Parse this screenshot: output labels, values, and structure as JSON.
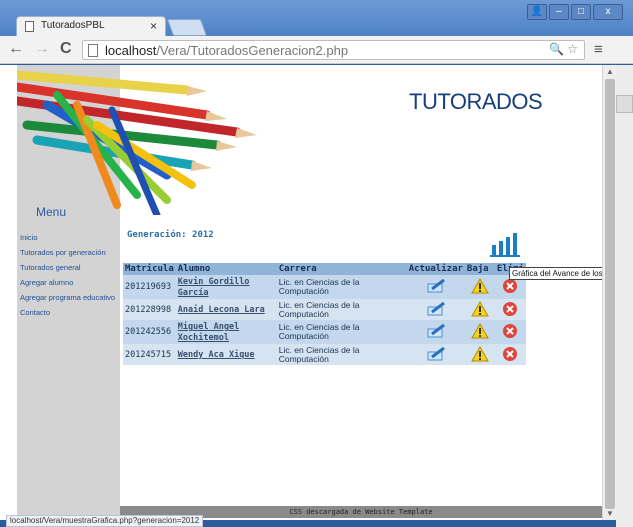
{
  "browser": {
    "tab_title": "TutoradosPBL",
    "tab_close": "×",
    "url_host": "localhost",
    "url_path": "/Vera/TutoradosGeneracion2.php",
    "back": "←",
    "forward": "→",
    "reload": "C",
    "menu": "≡",
    "omni_icons": "🔍 ☆",
    "win_minimize": "–",
    "win_maximize": "□",
    "win_close": "x",
    "win_user": "👤"
  },
  "page": {
    "title": "TUTORADOS",
    "menu_title": "Menu",
    "nav": [
      {
        "label": "Inicio"
      },
      {
        "label": "Tutorados por generación"
      },
      {
        "label": "Tutorados general"
      },
      {
        "label": "Agregar alumno"
      },
      {
        "label": "Agregar programa educativo"
      },
      {
        "label": "Contacto"
      }
    ],
    "generation_label": "Generación: 2012",
    "table": {
      "headers": [
        "Matricula",
        "Alumno",
        "Carrera",
        "Actualizar",
        "Baja",
        "Elimi"
      ],
      "rows": [
        {
          "matricula": "201219693",
          "alumno": "Kevin Gordillo García",
          "carrera": "Lic. en Ciencias de la Computación"
        },
        {
          "matricula": "201228998",
          "alumno": "Anaid Lecona Lara",
          "carrera": "Lic. en Ciencias de la Computación"
        },
        {
          "matricula": "201242556",
          "alumno": "Miguel Angel Xochitemol",
          "carrera": "Lic. en Ciencias de la Computación"
        },
        {
          "matricula": "201245715",
          "alumno": "Wendy Aca Xique",
          "carrera": "Lic. en Ciencias de la Computación"
        }
      ]
    },
    "tooltip": "Gráfica del Avance de los alumno",
    "footer": "CSS descargada de Website Template"
  },
  "status_url": "localhost/Vera/muestraGrafica.php?generacion=2012",
  "colors": {
    "accent": "#2a6fa8",
    "sidebar": "#d3d3d3",
    "table_header": "#8fb3d9",
    "row_odd": "#c3d8ec",
    "row_even": "#d6e4f2"
  },
  "icons": {
    "update": "pencil-notebook-icon",
    "deactivate": "warning-icon",
    "delete": "delete-x-icon",
    "chart": "bar-chart-icon"
  }
}
